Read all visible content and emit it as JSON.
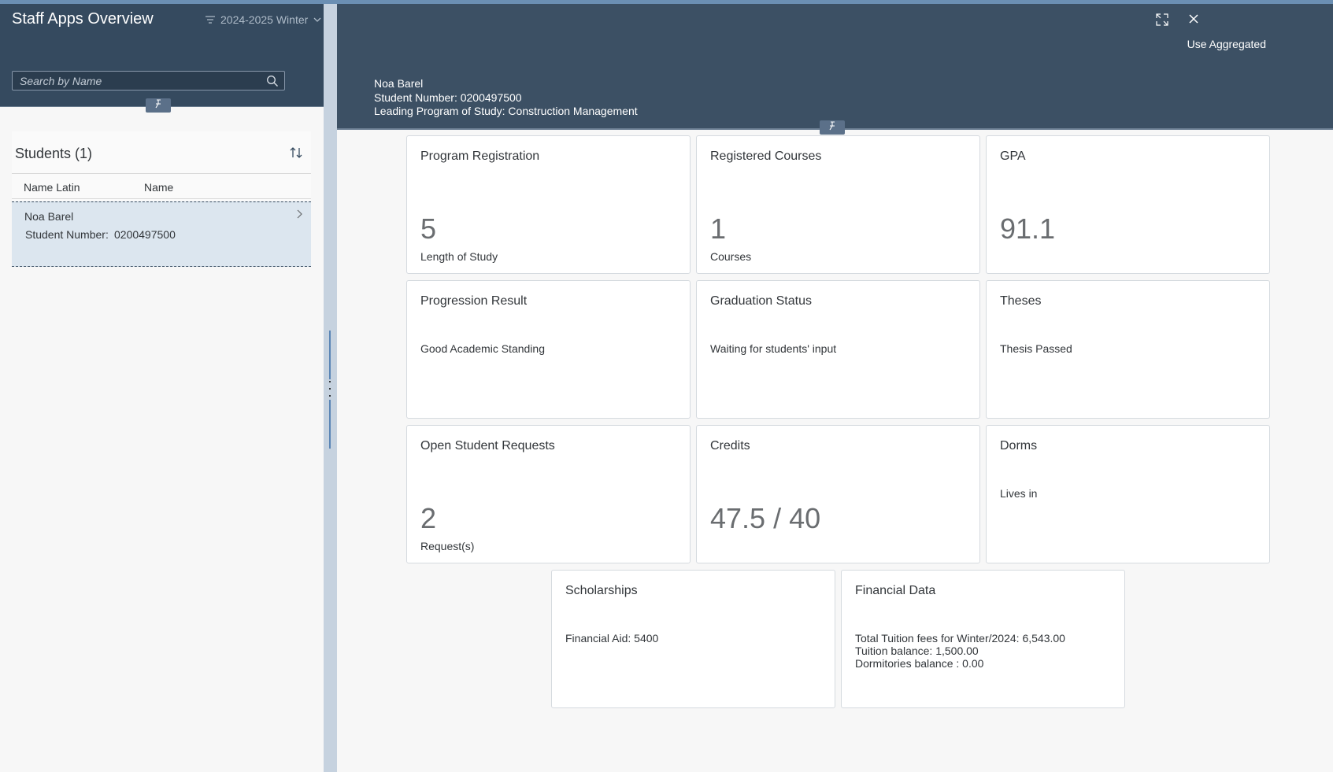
{
  "left": {
    "title": "Staff Apps Overview",
    "variant": "2024-2025 Winter",
    "search": {
      "placeholder": "Search by Name",
      "value": ""
    },
    "students": {
      "title": "Students (1)",
      "columns": [
        "Name Latin",
        "Name"
      ],
      "rows": [
        {
          "name": "Noa Barel",
          "number_label": "Student Number:",
          "number": "0200497500"
        }
      ]
    }
  },
  "header": {
    "use_aggregated": "Use Aggregated",
    "name": "Noa Barel",
    "student_number": "Student Number: 0200497500",
    "program": "Leading Program of Study: Construction Management"
  },
  "tiles": {
    "program_registration": {
      "title": "Program Registration",
      "value": "5",
      "unit": "Length of Study"
    },
    "registered_courses": {
      "title": "Registered Courses",
      "value": "1",
      "unit": "Courses"
    },
    "gpa": {
      "title": "GPA",
      "value": "91.1"
    },
    "progression_result": {
      "title": "Progression Result",
      "text": "Good Academic Standing"
    },
    "graduation_status": {
      "title": "Graduation Status",
      "text": "Waiting for students' input"
    },
    "theses": {
      "title": "Theses",
      "text": "Thesis Passed"
    },
    "open_requests": {
      "title": "Open Student Requests",
      "value": "2",
      "unit": "Request(s)"
    },
    "credits": {
      "title": "Credits",
      "value": "47.5 / 40"
    },
    "dorms": {
      "title": "Dorms",
      "text": "Lives in"
    },
    "scholarships": {
      "title": "Scholarships",
      "text": "Financial Aid: 5400"
    },
    "financial_data": {
      "title": "Financial Data",
      "line1": "Total Tuition fees for Winter/2024: 6,543.00",
      "line2": "Tuition balance: 1,500.00",
      "line3": "Dormitories balance : 0.00"
    }
  },
  "colors": {
    "shell_header": "#354a5f",
    "detail_header": "#3c5064",
    "selected_row": "#dce6ef",
    "splitter": "#c6d2df"
  }
}
